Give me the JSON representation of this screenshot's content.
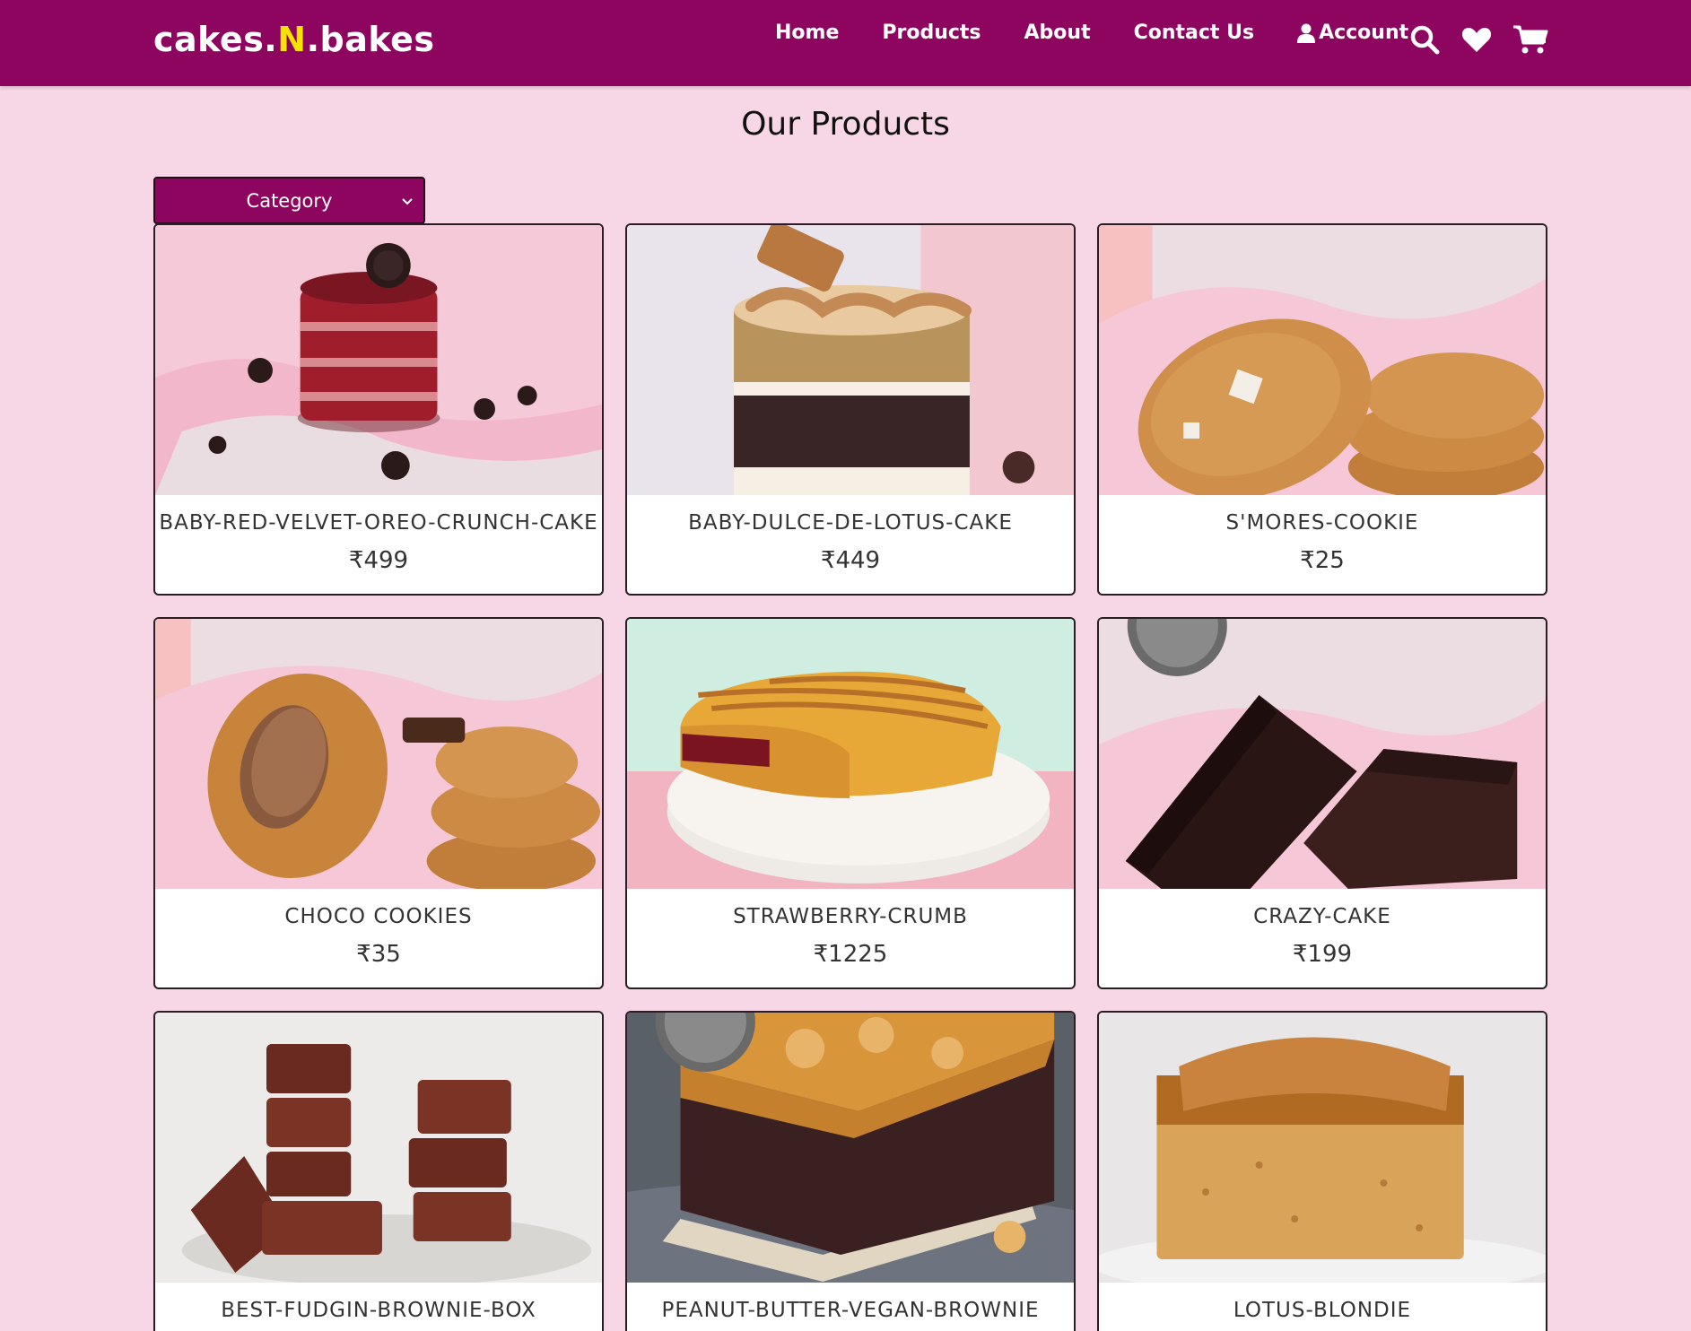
{
  "brand": {
    "prefix": "cakes.",
    "accent": "N",
    "suffix": ".bakes"
  },
  "nav": {
    "links": [
      "Home",
      "Products",
      "About",
      "Contact Us"
    ],
    "account_label": "Account",
    "icons": [
      "search-icon",
      "heart-icon",
      "cart-icon"
    ]
  },
  "page": {
    "title": "Our Products"
  },
  "filter": {
    "category_label": "Category"
  },
  "products": [
    {
      "name": "BABY-RED-VELVET-OREO-CRUNCH-CAKE",
      "price": "₹499"
    },
    {
      "name": "BABY-DULCE-DE-LOTUS-CAKE",
      "price": "₹449"
    },
    {
      "name": "S'MORES-COOKIE",
      "price": "₹25"
    },
    {
      "name": "CHOCO COOKIES",
      "price": "₹35"
    },
    {
      "name": "STRAWBERRY-CRUMB",
      "price": "₹1225"
    },
    {
      "name": "CRAZY-CAKE",
      "price": "₹199"
    },
    {
      "name": "BEST-FUDGIN-BROWNIE-BOX",
      "price": ""
    },
    {
      "name": "PEANUT-BUTTER-VEGAN-BROWNIE",
      "price": ""
    },
    {
      "name": "LOTUS-BLONDIE",
      "price": ""
    }
  ],
  "colors": {
    "header": "#8e0560",
    "page_background": "#f7d6e5",
    "brand_accent": "#f4e400"
  }
}
